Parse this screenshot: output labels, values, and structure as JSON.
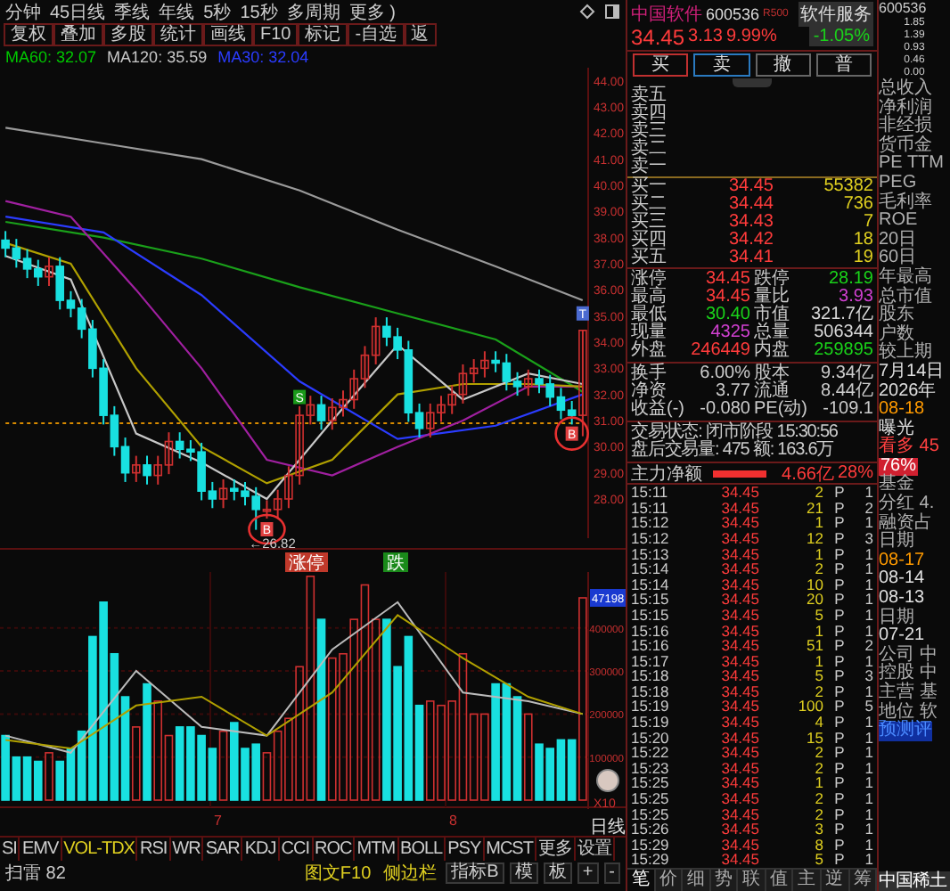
{
  "toolbar": {
    "periods": [
      "分钟",
      "45日线",
      "季线",
      "年线",
      "5秒",
      "15秒",
      "多周期",
      "更多 )"
    ],
    "buttons": [
      "复权",
      "叠加",
      "多股",
      "统计",
      "画线",
      "F10",
      "标记",
      "-自选",
      "返"
    ]
  },
  "ma_legend": [
    {
      "label": "MA60: 32.07",
      "color": "#00c800"
    },
    {
      "label": "MA120: 35.59",
      "color": "#c8c8c8"
    },
    {
      "label": "MA30: 32.04",
      "color": "#2b3cff"
    }
  ],
  "price_chart": {
    "chart_data": {
      "type": "candlestick",
      "ylim": [
        26.5,
        44.5
      ],
      "yticks": [
        {
          "value": 44,
          "label": "44.00"
        },
        {
          "value": 43,
          "label": "43.00"
        },
        {
          "value": 42,
          "label": "42.00"
        },
        {
          "value": 41,
          "label": "41.00"
        },
        {
          "value": 40,
          "label": "40.00"
        },
        {
          "value": 39,
          "label": "39.00"
        },
        {
          "value": 38,
          "label": "38.00"
        },
        {
          "value": 37,
          "label": "37.00"
        },
        {
          "value": 36,
          "label": "36.00"
        },
        {
          "value": 35,
          "label": "35.00"
        },
        {
          "value": 34,
          "label": "34.00"
        },
        {
          "value": 33,
          "label": "33.00"
        },
        {
          "value": 32,
          "label": "32.00"
        },
        {
          "value": 31,
          "label": "31.00"
        },
        {
          "value": 30,
          "label": "30.00"
        },
        {
          "value": 29,
          "label": "29.00"
        },
        {
          "value": 28,
          "label": "28.00"
        }
      ],
      "categories": [
        null,
        null,
        null,
        null,
        null,
        null,
        null,
        null,
        null,
        null,
        null,
        null,
        null,
        null,
        null,
        null,
        null,
        null,
        null,
        null,
        null,
        null,
        null,
        null,
        null,
        null,
        null,
        null,
        null,
        null,
        null,
        null,
        null,
        null,
        null,
        null,
        null,
        null,
        null,
        null,
        null,
        null,
        null,
        null,
        null,
        null,
        null,
        null,
        null,
        null,
        null,
        null,
        null,
        null
      ],
      "ohlc": [
        [
          37.9,
          38.25,
          37.25,
          37.6
        ],
        [
          37.6,
          37.95,
          36.85,
          37.2
        ],
        [
          37.2,
          37.55,
          36.45,
          36.8
        ],
        [
          36.8,
          37.15,
          36.15,
          36.5
        ],
        [
          36.5,
          37.25,
          36.15,
          36.9
        ],
        [
          36.9,
          37.25,
          35.25,
          35.6
        ],
        [
          35.6,
          35.95,
          34.95,
          35.3
        ],
        [
          35.3,
          35.65,
          34.15,
          34.5
        ],
        [
          34.5,
          34.85,
          32.65,
          33.0
        ],
        [
          33.0,
          33.35,
          30.85,
          31.2
        ],
        [
          31.2,
          31.55,
          29.65,
          30.0
        ],
        [
          30.0,
          30.35,
          28.65,
          29.0
        ],
        [
          29.0,
          29.65,
          28.65,
          29.3
        ],
        [
          29.3,
          29.65,
          28.55,
          28.9
        ],
        [
          28.9,
          29.65,
          28.55,
          29.3
        ],
        [
          29.3,
          30.55,
          28.95,
          30.2
        ],
        [
          30.2,
          30.55,
          29.55,
          29.9
        ],
        [
          29.9,
          30.25,
          29.45,
          29.8
        ],
        [
          29.8,
          30.15,
          27.95,
          28.3
        ],
        [
          28.3,
          28.65,
          27.65,
          28.0
        ],
        [
          28.0,
          28.75,
          27.65,
          28.4
        ],
        [
          28.4,
          28.75,
          27.95,
          28.3
        ],
        [
          28.3,
          28.65,
          27.75,
          28.1
        ],
        [
          28.1,
          28.45,
          26.82,
          27.6
        ],
        [
          27.6,
          27.95,
          27.25,
          27.6
        ],
        [
          27.6,
          28.35,
          27.25,
          28.0
        ],
        [
          28.0,
          29.25,
          27.65,
          28.9
        ],
        [
          28.9,
          31.55,
          28.55,
          31.2
        ],
        [
          31.2,
          31.95,
          30.85,
          31.6
        ],
        [
          31.6,
          31.95,
          30.65,
          31.0
        ],
        [
          31.0,
          31.85,
          30.65,
          31.5
        ],
        [
          31.5,
          32.15,
          31.15,
          31.8
        ],
        [
          31.8,
          32.95,
          31.45,
          32.6
        ],
        [
          32.6,
          33.85,
          32.25,
          33.5
        ],
        [
          33.5,
          34.95,
          33.15,
          34.6
        ],
        [
          34.6,
          34.95,
          33.85,
          34.2
        ],
        [
          34.2,
          34.55,
          33.35,
          33.7
        ],
        [
          33.7,
          34.05,
          30.95,
          31.3
        ],
        [
          31.3,
          31.65,
          30.35,
          30.7
        ],
        [
          30.7,
          31.65,
          30.35,
          31.3
        ],
        [
          31.3,
          31.95,
          30.95,
          31.6
        ],
        [
          31.6,
          32.35,
          31.25,
          32.0
        ],
        [
          32.0,
          33.15,
          31.65,
          32.8
        ],
        [
          32.8,
          33.35,
          32.45,
          33.0
        ],
        [
          33.0,
          33.65,
          32.65,
          33.3
        ],
        [
          33.3,
          33.65,
          32.85,
          33.2
        ],
        [
          33.2,
          33.55,
          32.15,
          32.5
        ],
        [
          32.5,
          32.85,
          31.95,
          32.3
        ],
        [
          32.3,
          32.95,
          31.95,
          32.6
        ],
        [
          32.6,
          32.95,
          32.05,
          32.4
        ],
        [
          32.4,
          32.75,
          31.55,
          31.9
        ],
        [
          31.9,
          32.25,
          31.05,
          31.4
        ],
        [
          31.4,
          31.75,
          30.85,
          31.2
        ],
        [
          31.2,
          34.45,
          30.4,
          34.45
        ]
      ],
      "series": [
        {
          "type": "line",
          "line_style": "dashed",
          "color": "#d88a00",
          "values": [
            30.9,
            null,
            null,
            null,
            null,
            null,
            null,
            null,
            null,
            null,
            null,
            null,
            null,
            null,
            null,
            null,
            null,
            null,
            null,
            null,
            null,
            null,
            null,
            null,
            null,
            null,
            null,
            null,
            null,
            null,
            null,
            null,
            null,
            null,
            null,
            null,
            null,
            null,
            null,
            null,
            null,
            null,
            null,
            null,
            null,
            null,
            null,
            null,
            null,
            null,
            null,
            null,
            null,
            30.9
          ]
        },
        {
          "type": "line",
          "color": "#9a9a9a",
          "values": [
            42.2,
            null,
            null,
            null,
            null,
            null,
            null,
            null,
            null,
            41.6,
            null,
            null,
            null,
            null,
            null,
            null,
            null,
            null,
            41.0,
            null,
            null,
            null,
            null,
            null,
            null,
            null,
            null,
            39.8,
            null,
            null,
            null,
            null,
            null,
            null,
            null,
            null,
            38.3,
            null,
            null,
            null,
            null,
            null,
            null,
            null,
            null,
            36.9,
            null,
            null,
            null,
            null,
            null,
            null,
            null,
            35.6
          ]
        },
        {
          "type": "line",
          "color": "#1aa01a",
          "values": [
            38.6,
            null,
            null,
            null,
            null,
            null,
            null,
            null,
            null,
            38.0,
            null,
            null,
            null,
            null,
            null,
            null,
            null,
            null,
            37.2,
            null,
            null,
            null,
            null,
            null,
            null,
            null,
            null,
            36.1,
            null,
            null,
            null,
            null,
            null,
            null,
            null,
            null,
            35.1,
            null,
            null,
            null,
            null,
            null,
            null,
            null,
            null,
            34.1,
            null,
            null,
            null,
            null,
            null,
            null,
            null,
            32.1
          ]
        },
        {
          "type": "line",
          "color": "#2b3cff",
          "values": [
            38.8,
            null,
            null,
            null,
            null,
            null,
            null,
            null,
            null,
            38.2,
            null,
            null,
            null,
            null,
            null,
            null,
            null,
            null,
            35.8,
            null,
            null,
            null,
            null,
            null,
            null,
            null,
            null,
            32.5,
            null,
            null,
            null,
            null,
            null,
            null,
            null,
            null,
            30.3,
            null,
            null,
            null,
            null,
            null,
            null,
            null,
            null,
            30.8,
            null,
            null,
            null,
            null,
            null,
            null,
            null,
            32.0
          ]
        },
        {
          "type": "line",
          "color": "#a020a0",
          "values": [
            39.4,
            null,
            null,
            null,
            null,
            null,
            38.8,
            null,
            null,
            null,
            null,
            null,
            36.0,
            null,
            null,
            null,
            null,
            null,
            33.0,
            null,
            null,
            null,
            null,
            null,
            29.5,
            null,
            null,
            null,
            null,
            null,
            28.9,
            null,
            null,
            null,
            null,
            null,
            30.0,
            null,
            null,
            null,
            null,
            null,
            31.0,
            null,
            null,
            null,
            null,
            null,
            32.3,
            null,
            null,
            null,
            null,
            32.3
          ]
        },
        {
          "type": "line",
          "color": "#b0a000",
          "values": [
            37.8,
            null,
            null,
            null,
            null,
            null,
            37.0,
            null,
            null,
            null,
            null,
            null,
            33.0,
            null,
            null,
            null,
            null,
            null,
            30.0,
            null,
            null,
            null,
            null,
            null,
            28.6,
            null,
            null,
            null,
            null,
            null,
            29.5,
            null,
            null,
            null,
            null,
            null,
            32.0,
            null,
            null,
            null,
            null,
            null,
            32.4,
            null,
            null,
            null,
            null,
            null,
            32.4,
            null,
            null,
            null,
            null,
            32.3
          ]
        },
        {
          "type": "line",
          "color": "#c8c8c8",
          "values": [
            37.3,
            null,
            null,
            null,
            null,
            null,
            36.4,
            null,
            null,
            null,
            null,
            null,
            30.5,
            null,
            null,
            null,
            null,
            null,
            29.4,
            null,
            null,
            null,
            null,
            null,
            28.0,
            null,
            null,
            null,
            null,
            null,
            31.0,
            null,
            null,
            null,
            null,
            null,
            33.9,
            null,
            null,
            null,
            null,
            null,
            31.8,
            null,
            null,
            null,
            null,
            null,
            32.8,
            null,
            null,
            null,
            null,
            32.4
          ]
        }
      ]
    }
  },
  "chart_marks": [
    {
      "kind": "sell",
      "text": "S"
    },
    {
      "kind": "buy",
      "text": "B"
    },
    {
      "kind": "top",
      "text": "T"
    },
    {
      "kind": "buy",
      "text": "B"
    }
  ],
  "low_label": "←26.82",
  "event_tags": [
    {
      "kind": "up",
      "text": "涨停"
    },
    {
      "kind": "down",
      "text": "跌"
    }
  ],
  "volume": {
    "current": "47198",
    "unit": "X10",
    "months": [
      "7",
      "8"
    ],
    "period": "日线",
    "chart_data": {
      "type": "bar",
      "ylim": [
        0,
        530000
      ],
      "grid": true,
      "yticks": [
        {
          "value": 400000,
          "label": "400000"
        },
        {
          "value": 300000,
          "label": "300000"
        },
        {
          "value": 200000,
          "label": "200000"
        },
        {
          "value": 100000,
          "label": "100000"
        }
      ],
      "categories": [
        null,
        null,
        null,
        null,
        null,
        null,
        null,
        null,
        null,
        null,
        null,
        null,
        null,
        null,
        null,
        null,
        null,
        null,
        null,
        null,
        null,
        null,
        null,
        null,
        null,
        null,
        null,
        null,
        null,
        null,
        null,
        null,
        null,
        null,
        null,
        null,
        null,
        null,
        null,
        null,
        null,
        null,
        null,
        null,
        null,
        null,
        null,
        null,
        null,
        null,
        null,
        null,
        null,
        null
      ],
      "values": [
        150000,
        100000,
        100000,
        90000,
        110000,
        90000,
        120000,
        160000,
        380000,
        460000,
        340000,
        240000,
        170000,
        270000,
        230000,
        150000,
        170000,
        170000,
        150000,
        120000,
        160000,
        180000,
        120000,
        130000,
        110000,
        160000,
        190000,
        310000,
        520000,
        420000,
        330000,
        340000,
        420000,
        500000,
        420000,
        420000,
        310000,
        380000,
        220000,
        230000,
        220000,
        230000,
        340000,
        200000,
        200000,
        270000,
        270000,
        240000,
        200000,
        130000,
        120000,
        140000,
        140000,
        470000
      ],
      "colors": [
        "#19e0e0",
        "#19e0e0",
        "#19e0e0",
        "#19e0e0",
        "#d03030",
        "#19e0e0",
        "#19e0e0",
        "#19e0e0",
        "#19e0e0",
        "#19e0e0",
        "#19e0e0",
        "#19e0e0",
        "#d03030",
        "#19e0e0",
        "#d03030",
        "#d03030",
        "#19e0e0",
        "#19e0e0",
        "#19e0e0",
        "#19e0e0",
        "#d03030",
        "#19e0e0",
        "#19e0e0",
        "#19e0e0",
        "#d03030",
        "#d03030",
        "#d03030",
        "#d03030",
        "#d03030",
        "#19e0e0",
        "#d03030",
        "#d03030",
        "#d03030",
        "#d03030",
        "#d03030",
        "#19e0e0",
        "#19e0e0",
        "#19e0e0",
        "#19e0e0",
        "#d03030",
        "#d03030",
        "#d03030",
        "#d03030",
        "#d03030",
        "#d03030",
        "#19e0e0",
        "#19e0e0",
        "#19e0e0",
        "#d03030",
        "#19e0e0",
        "#19e0e0",
        "#19e0e0",
        "#19e0e0",
        "#d03030"
      ],
      "series": [
        {
          "type": "line",
          "color": "#bbbbbb",
          "values": [
            150000,
            null,
            null,
            null,
            null,
            null,
            110000,
            null,
            null,
            null,
            null,
            null,
            300000,
            null,
            null,
            null,
            null,
            null,
            170000,
            null,
            null,
            null,
            null,
            null,
            150000,
            null,
            null,
            null,
            null,
            null,
            350000,
            null,
            null,
            null,
            null,
            null,
            460000,
            null,
            null,
            null,
            null,
            null,
            250000,
            null,
            null,
            null,
            null,
            null,
            230000,
            null,
            null,
            null,
            null,
            200000
          ]
        },
        {
          "type": "line",
          "color": "#b0a000",
          "values": [
            140000,
            null,
            null,
            null,
            null,
            null,
            120000,
            null,
            null,
            null,
            null,
            null,
            220000,
            null,
            null,
            null,
            null,
            null,
            240000,
            null,
            null,
            null,
            null,
            null,
            150000,
            null,
            null,
            null,
            null,
            null,
            250000,
            null,
            null,
            null,
            null,
            null,
            430000,
            null,
            null,
            null,
            null,
            null,
            330000,
            null,
            null,
            null,
            null,
            null,
            240000,
            null,
            null,
            null,
            null,
            200000
          ]
        }
      ]
    }
  },
  "indicator_tabs": [
    {
      "label": "SI",
      "selected": false
    },
    {
      "label": "EMV",
      "selected": false
    },
    {
      "label": "VOL-TDX",
      "selected": true
    },
    {
      "label": "RSI",
      "selected": false
    },
    {
      "label": "WR",
      "selected": false
    },
    {
      "label": "SAR",
      "selected": false
    },
    {
      "label": "KDJ",
      "selected": false
    },
    {
      "label": "CCI",
      "selected": false
    },
    {
      "label": "ROC",
      "selected": false
    },
    {
      "label": "MTM",
      "selected": false
    },
    {
      "label": "BOLL",
      "selected": false
    },
    {
      "label": "PSY",
      "selected": false
    },
    {
      "label": "MCST",
      "selected": false
    },
    {
      "label": "更多",
      "selected": false
    },
    {
      "label": "设置",
      "selected": false
    }
  ],
  "indicator_tools": [
    "指标B",
    "模",
    "板",
    "+",
    "-"
  ],
  "status": {
    "left": "扫雷 82",
    "right": [
      "图文F10",
      "侧边栏"
    ]
  },
  "quote": {
    "name": "中国软件",
    "code": "600536",
    "badge": "R500",
    "industry": "软件服务",
    "industry_change": "-1.05%",
    "price": "34.45",
    "change": "3.13",
    "change_pct": "9.99%"
  },
  "trade_buttons": [
    {
      "label": "买",
      "kind": "buy"
    },
    {
      "label": "卖",
      "kind": "sell"
    },
    {
      "label": "撤",
      "kind": "plain"
    },
    {
      "label": "普",
      "kind": "plain"
    }
  ],
  "asks": [
    "卖五",
    "卖四",
    "卖三",
    "卖二",
    "卖一"
  ],
  "bids": [
    {
      "label": "买一",
      "price": "34.45",
      "volume": "55382"
    },
    {
      "label": "买二",
      "price": "34.44",
      "volume": "736"
    },
    {
      "label": "买三",
      "price": "34.43",
      "volume": "7"
    },
    {
      "label": "买四",
      "price": "34.42",
      "volume": "18"
    },
    {
      "label": "买五",
      "price": "34.41",
      "volume": "19"
    }
  ],
  "stats": [
    {
      "label": "涨停",
      "value": "34.45",
      "color": "#ff3b3b"
    },
    {
      "label": "跌停",
      "value": "28.19",
      "color": "#1ad21a"
    },
    {
      "label": "最高",
      "value": "34.45",
      "color": "#ff3b3b"
    },
    {
      "label": "量比",
      "value": "3.93",
      "color": "#d040d0"
    },
    {
      "label": "最低",
      "value": "30.40",
      "color": "#1ad21a"
    },
    {
      "label": "市值",
      "value": "321.7亿",
      "color": "#d8d8d8"
    },
    {
      "label": "现量",
      "value": "4325",
      "color": "#d040d0"
    },
    {
      "label": "总量",
      "value": "506344",
      "color": "#d8d8d8"
    },
    {
      "label": "外盘",
      "value": "246449",
      "color": "#ff3b3b"
    },
    {
      "label": "内盘",
      "value": "259895",
      "color": "#1ad21a"
    }
  ],
  "fundamentals": [
    {
      "label": "换手",
      "value": "6.00%"
    },
    {
      "label": "股本",
      "value": "9.34亿"
    },
    {
      "label": "净资",
      "value": "3.77"
    },
    {
      "label": "流通",
      "value": "8.44亿"
    },
    {
      "label": "收益(-)",
      "value": "-0.080"
    },
    {
      "label": "PE(动)",
      "value": "-109.1"
    }
  ],
  "status_lines": [
    "交易状态: 闭市阶段 15:30:56",
    "盘后交易量: 475 额: 163.6万"
  ],
  "main_force": {
    "label": "主力净额",
    "value": "4.66亿",
    "pct": "28%"
  },
  "ticks": [
    {
      "time": "15:11",
      "price": "34.45",
      "volume": "2",
      "type": "P",
      "column_5": "1"
    },
    {
      "time": "15:11",
      "price": "34.45",
      "volume": "21",
      "type": "P",
      "column_5": "2"
    },
    {
      "time": "15:12",
      "price": "34.45",
      "volume": "1",
      "type": "P",
      "column_5": "1"
    },
    {
      "time": "15:12",
      "price": "34.45",
      "volume": "12",
      "type": "P",
      "column_5": "3"
    },
    {
      "time": "15:13",
      "price": "34.45",
      "volume": "1",
      "type": "P",
      "column_5": "1"
    },
    {
      "time": "15:14",
      "price": "34.45",
      "volume": "2",
      "type": "P",
      "column_5": "1"
    },
    {
      "time": "15:14",
      "price": "34.45",
      "volume": "10",
      "type": "P",
      "column_5": "1"
    },
    {
      "time": "15:15",
      "price": "34.45",
      "volume": "20",
      "type": "P",
      "column_5": "1"
    },
    {
      "time": "15:15",
      "price": "34.45",
      "volume": "5",
      "type": "P",
      "column_5": "1"
    },
    {
      "time": "15:16",
      "price": "34.45",
      "volume": "1",
      "type": "P",
      "column_5": "1"
    },
    {
      "time": "15:16",
      "price": "34.45",
      "volume": "51",
      "type": "P",
      "column_5": "2"
    },
    {
      "time": "15:17",
      "price": "34.45",
      "volume": "1",
      "type": "P",
      "column_5": "1"
    },
    {
      "time": "15:18",
      "price": "34.45",
      "volume": "5",
      "type": "P",
      "column_5": "3"
    },
    {
      "time": "15:18",
      "price": "34.45",
      "volume": "2",
      "type": "P",
      "column_5": "1"
    },
    {
      "time": "15:19",
      "price": "34.45",
      "volume": "100",
      "type": "P",
      "column_5": "5"
    },
    {
      "time": "15:19",
      "price": "34.45",
      "volume": "4",
      "type": "P",
      "column_5": "1"
    },
    {
      "time": "15:20",
      "price": "34.45",
      "volume": "15",
      "type": "P",
      "column_5": "1"
    },
    {
      "time": "15:22",
      "price": "34.45",
      "volume": "2",
      "type": "P",
      "column_5": "1"
    },
    {
      "time": "15:23",
      "price": "34.45",
      "volume": "2",
      "type": "P",
      "column_5": "1"
    },
    {
      "time": "15:25",
      "price": "34.45",
      "volume": "1",
      "type": "P",
      "column_5": "1"
    },
    {
      "time": "15:25",
      "price": "34.45",
      "volume": "2",
      "type": "P",
      "column_5": "1"
    },
    {
      "time": "15:25",
      "price": "34.45",
      "volume": "2",
      "type": "P",
      "column_5": "1"
    },
    {
      "time": "15:26",
      "price": "34.45",
      "volume": "3",
      "type": "P",
      "column_5": "1"
    },
    {
      "time": "15:29",
      "price": "34.45",
      "volume": "8",
      "type": "P",
      "column_5": "1"
    },
    {
      "time": "15:29",
      "price": "34.45",
      "volume": "5",
      "type": "P",
      "column_5": "1"
    }
  ],
  "tick_tabs": [
    {
      "label": "笔",
      "selected": true
    },
    {
      "label": "价",
      "selected": false
    },
    {
      "label": "细",
      "selected": false
    },
    {
      "label": "势",
      "selected": false
    },
    {
      "label": "联",
      "selected": false
    },
    {
      "label": "值",
      "selected": false
    },
    {
      "label": "主",
      "selected": false
    },
    {
      "label": "逆",
      "selected": false
    },
    {
      "label": "筹",
      "selected": false
    }
  ],
  "side": {
    "code": "600536",
    "scale": [
      "1.85",
      "1.39",
      "0.93",
      "0.46",
      "0.00"
    ],
    "items": [
      {
        "text": "总收入",
        "kind": "text",
        "color": "#b0b0b0"
      },
      {
        "text": "净利润",
        "kind": "text",
        "color": "#b0b0b0"
      },
      {
        "text": "非经损",
        "kind": "text",
        "color": "#b0b0b0"
      },
      {
        "text": "货币金",
        "kind": "text",
        "color": "#b0b0b0"
      },
      {
        "text": "PE TTM",
        "kind": "text",
        "color": "#b0b0b0"
      },
      {
        "text": "PEG",
        "kind": "text",
        "color": "#b0b0b0"
      },
      {
        "text": "毛利率",
        "kind": "text",
        "color": "#b0b0b0"
      },
      {
        "text": "ROE",
        "kind": "text",
        "color": "#b0b0b0"
      },
      {
        "text": "20日",
        "kind": "text",
        "color": "#b0b0b0"
      },
      {
        "text": "60日",
        "kind": "text",
        "color": "#b0b0b0"
      },
      {
        "text": "年最高",
        "kind": "text",
        "color": "#b0b0b0"
      },
      {
        "text": "总市值",
        "kind": "text",
        "color": "#b0b0b0"
      },
      {
        "text": "股东",
        "kind": "text",
        "color": "#b0b0b0"
      },
      {
        "text": "户数",
        "kind": "text",
        "color": "#b0b0b0"
      },
      {
        "text": "较上期",
        "kind": "text",
        "color": "#b0b0b0"
      },
      {
        "text": "7月14日",
        "kind": "text",
        "color": "#e0e0e0"
      },
      {
        "text": "2026年",
        "kind": "text",
        "color": "#e0e0e0"
      },
      {
        "text": "08-18",
        "kind": "text",
        "color": "#ff9a00"
      },
      {
        "text": "曝光",
        "kind": "text",
        "color": "#e0e0e0"
      },
      {
        "text": "看多 45",
        "kind": "text",
        "color": "#ff4040"
      },
      {
        "text": "76%",
        "kind": "badge",
        "color": "#d02030"
      },
      {
        "text": "基金",
        "kind": "text",
        "color": "#b0b0b0"
      },
      {
        "text": "分红 4.",
        "kind": "text",
        "color": "#b0b0b0"
      },
      {
        "text": "融资占",
        "kind": "text",
        "color": "#b0b0b0"
      },
      {
        "text": "日期",
        "kind": "text",
        "color": "#b0b0b0"
      },
      {
        "text": "08-17",
        "kind": "text",
        "color": "#ff9a00"
      },
      {
        "text": "08-14",
        "kind": "text",
        "color": "#e0e0e0"
      },
      {
        "text": "08-13",
        "kind": "text",
        "color": "#e0e0e0"
      },
      {
        "text": "日期",
        "kind": "text",
        "color": "#b0b0b0"
      },
      {
        "text": "07-21",
        "kind": "text",
        "color": "#e0e0e0"
      },
      {
        "text": "公司 中",
        "kind": "text",
        "color": "#b0b0b0"
      },
      {
        "text": "控股 中",
        "kind": "text",
        "color": "#b0b0b0"
      },
      {
        "text": "主营 基",
        "kind": "text",
        "color": "#b0b0b0"
      },
      {
        "text": "地位 软",
        "kind": "text",
        "color": "#b0b0b0"
      },
      {
        "text": "预测评",
        "kind": "link",
        "color": "#1030a0"
      }
    ],
    "footer": "中国稀土"
  }
}
